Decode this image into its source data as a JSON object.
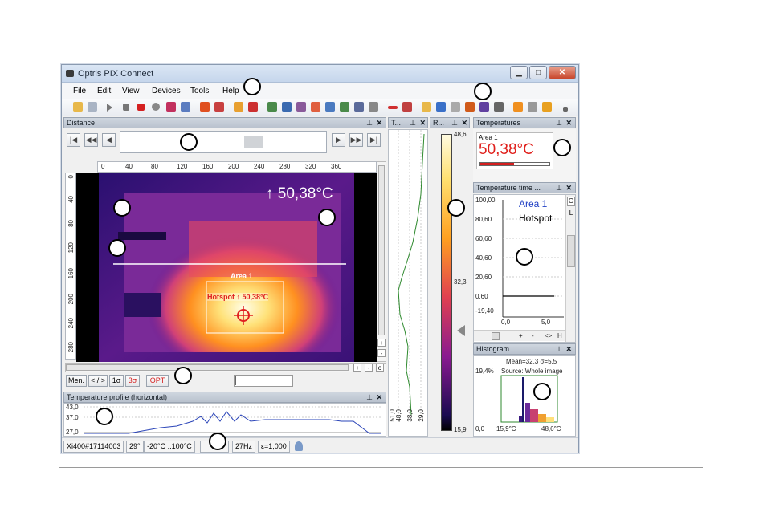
{
  "window": {
    "title": "Optris PIX Connect"
  },
  "menu": [
    "File",
    "Edit",
    "View",
    "Devices",
    "Tools",
    "Help"
  ],
  "distance_panel": {
    "title": "Distance"
  },
  "ruler_x": [
    "0",
    "40",
    "80",
    "120",
    "160",
    "200",
    "240",
    "280",
    "320",
    "360"
  ],
  "ruler_y": [
    "0",
    "40",
    "80",
    "120",
    "160",
    "200",
    "240",
    "280"
  ],
  "thermal_image": {
    "max_readout": "↑ 50,38°C",
    "area_label": "Area 1",
    "hotspot_label": "Hotspot ↑ 50,38°C"
  },
  "view_buttons": {
    "men": "Men.",
    "arrows": "< / >",
    "sigma1": "1σ",
    "sigma3": "3σ",
    "opt": "OPT"
  },
  "profile_panel": {
    "title": "Temperature profile (horizontal)",
    "y_ticks": [
      "43,0",
      "37,0",
      "27,0"
    ]
  },
  "t_panel": {
    "title": "T...",
    "x_ticks": [
      "51,0",
      "48,0",
      "38,0",
      "29,0"
    ]
  },
  "r_panel": {
    "title": "R...",
    "scale_top": "48,6",
    "scale_mid": "32,3",
    "scale_bottom": "15,9"
  },
  "temperatures_panel": {
    "title": "Temperatures",
    "area": "Area 1",
    "value": "50,38°C"
  },
  "time_panel": {
    "title": "Temperature time ...",
    "y_ticks": [
      "100,00",
      "80,60",
      "60,60",
      "40,60",
      "20,60",
      "0,60",
      "-19,40"
    ],
    "x_ticks": [
      "0,0",
      "5,0"
    ],
    "legend_area": "Area 1",
    "legend_hotspot": "Hotspot",
    "side_buttons": [
      "G",
      "L"
    ],
    "bottom_controls": [
      "+",
      "-",
      "<>",
      "H"
    ]
  },
  "histogram_panel": {
    "title": "Histogram",
    "stats": "Mean=32,3 σ=5,5",
    "source": "Source: Whole image",
    "pct": "19,4%",
    "x_min": "0,0",
    "x_left": "15,9°C",
    "x_right": "48,6°C"
  },
  "status": {
    "device": "Xi400#17114003",
    "fov": "29°",
    "range": "-20°C ..100°C",
    "rate": "27Hz",
    "emissivity": "ε=1,000"
  },
  "colors": {
    "readout_red": "#e0201c",
    "legend_blue": "#1f3fc4",
    "profile_blue": "#2a44b8",
    "series_green": "#2f8a2f"
  }
}
